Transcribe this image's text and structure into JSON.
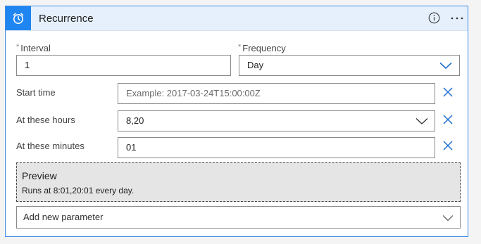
{
  "header": {
    "title": "Recurrence",
    "icon": "alarm-clock-icon",
    "accent_color": "#1f85f0"
  },
  "interval": {
    "label": "Interval",
    "required_mark": "*",
    "value": "1"
  },
  "frequency": {
    "label": "Frequency",
    "required_mark": "*",
    "value": "Day"
  },
  "start_time": {
    "label": "Start time",
    "placeholder": "Example: 2017-03-24T15:00:00Z"
  },
  "at_hours": {
    "label": "At these hours",
    "value": "8,20"
  },
  "at_minutes": {
    "label": "At these minutes",
    "value": "01"
  },
  "preview": {
    "title": "Preview",
    "text": "Runs at 8:01,20:01 every day."
  },
  "add_parameter": {
    "label": "Add new parameter"
  }
}
